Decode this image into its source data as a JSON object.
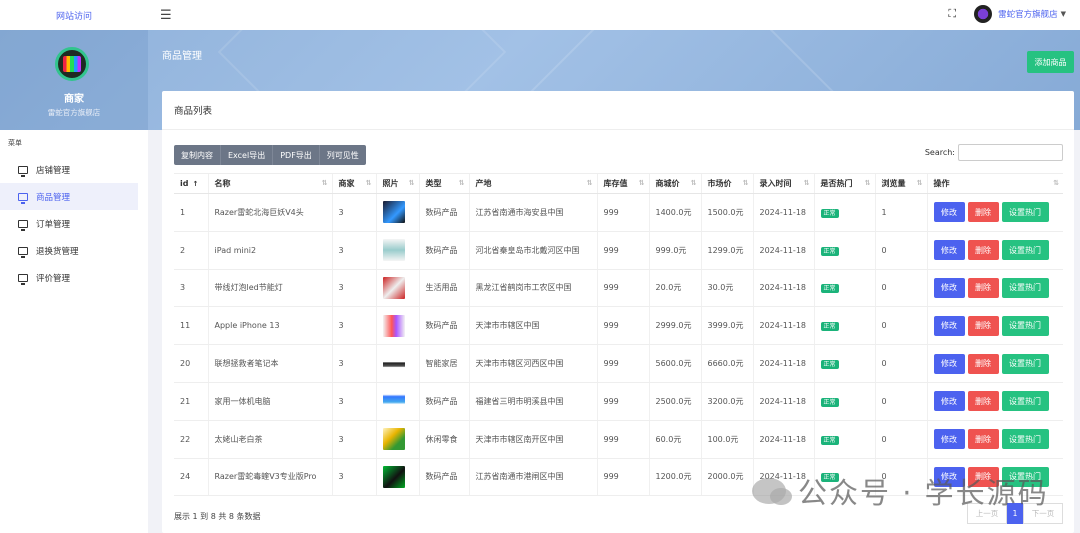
{
  "topbar": {
    "site_link": "网站访问",
    "store_name": "雷蛇官方旗舰店",
    "menu_icon": "hamburger-icon",
    "fullscreen_icon": "fullscreen-icon"
  },
  "profile": {
    "name": "商家",
    "subtitle": "雷蛇官方旗舰店"
  },
  "page": {
    "title": "商品管理",
    "add_button": "添加商品"
  },
  "sidebar": {
    "header": "菜单",
    "items": [
      {
        "label": "店铺管理",
        "active": false
      },
      {
        "label": "商品管理",
        "active": true
      },
      {
        "label": "订单管理",
        "active": false
      },
      {
        "label": "退换货管理",
        "active": false
      },
      {
        "label": "评价管理",
        "active": false
      }
    ]
  },
  "card": {
    "title": "商品列表",
    "export_buttons": [
      "复制内容",
      "Excel导出",
      "PDF导出",
      "列可见性"
    ],
    "search_label": "Search:",
    "search_value": ""
  },
  "table": {
    "columns": [
      "id",
      "名称",
      "商家",
      "照片",
      "类型",
      "产地",
      "库存值",
      "商城价",
      "市场价",
      "录入时间",
      "是否热门",
      "浏览量",
      "操作"
    ],
    "rows": [
      {
        "id": "1",
        "name": "Razer雷蛇北海巨妖V4头",
        "merchant": "3",
        "type": "数码产品",
        "origin": "江苏省南通市海安县中国",
        "stock": "999",
        "price": "1400.0元",
        "market": "1500.0元",
        "date": "2024-11-18",
        "hot": "正常",
        "views": "1"
      },
      {
        "id": "2",
        "name": "iPad mini2",
        "merchant": "3",
        "type": "数码产品",
        "origin": "河北省秦皇岛市北戴河区中国",
        "stock": "999",
        "price": "999.0元",
        "market": "1299.0元",
        "date": "2024-11-18",
        "hot": "正常",
        "views": "0"
      },
      {
        "id": "3",
        "name": "带线灯泡led节能灯",
        "merchant": "3",
        "type": "生活用品",
        "origin": "黑龙江省鹤岗市工农区中国",
        "stock": "999",
        "price": "20.0元",
        "market": "30.0元",
        "date": "2024-11-18",
        "hot": "正常",
        "views": "0"
      },
      {
        "id": "11",
        "name": "Apple iPhone 13",
        "merchant": "3",
        "type": "数码产品",
        "origin": "天津市市辖区中国",
        "stock": "999",
        "price": "2999.0元",
        "market": "3999.0元",
        "date": "2024-11-18",
        "hot": "正常",
        "views": "0"
      },
      {
        "id": "20",
        "name": "联想拯救者笔记本",
        "merchant": "3",
        "type": "智能家居",
        "origin": "天津市市辖区河西区中国",
        "stock": "999",
        "price": "5600.0元",
        "market": "6660.0元",
        "date": "2024-11-18",
        "hot": "正常",
        "views": "0"
      },
      {
        "id": "21",
        "name": "家用一体机电脑",
        "merchant": "3",
        "type": "数码产品",
        "origin": "福建省三明市明溪县中国",
        "stock": "999",
        "price": "2500.0元",
        "market": "3200.0元",
        "date": "2024-11-18",
        "hot": "正常",
        "views": "0"
      },
      {
        "id": "22",
        "name": "太姥山老白茶",
        "merchant": "3",
        "type": "休闲零食",
        "origin": "天津市市辖区南开区中国",
        "stock": "999",
        "price": "60.0元",
        "market": "100.0元",
        "date": "2024-11-18",
        "hot": "正常",
        "views": "0"
      },
      {
        "id": "24",
        "name": "Razer雷蛇毒蝰V3专业版Pro",
        "merchant": "3",
        "type": "数码产品",
        "origin": "江苏省南通市港闸区中国",
        "stock": "999",
        "price": "1200.0元",
        "market": "2000.0元",
        "date": "2024-11-18",
        "hot": "正常",
        "views": "0"
      }
    ],
    "action_labels": {
      "edit": "修改",
      "delete": "删除",
      "set_hot": "设置热门"
    }
  },
  "footer": {
    "info": "展示 1 到 8 共 8 条数据",
    "prev": "上一页",
    "current_page": "1",
    "next": "下一页"
  },
  "watermark": {
    "text": "公众号 · 学长源码"
  },
  "colors": {
    "primary": "#4c62ef",
    "success": "#26c281",
    "danger": "#ef5350",
    "header_bg": "#8fb1da"
  }
}
